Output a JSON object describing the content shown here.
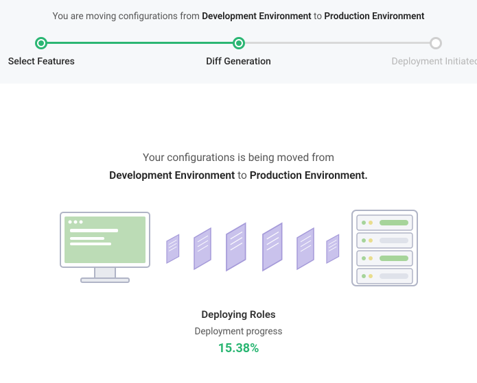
{
  "header": {
    "prefix": "You are moving configurations from",
    "from_env": "Development Environment",
    "mid": "to",
    "to_env": "Production Environment"
  },
  "stepper": {
    "steps": [
      {
        "label": "Select Features",
        "state": "done",
        "pos": 3
      },
      {
        "label": "Diff Generation",
        "state": "done",
        "pos": 50
      },
      {
        "label": "Deployment Initiated",
        "state": "todo",
        "pos": 97
      }
    ]
  },
  "body": {
    "line1": "Your configurations is being moved from",
    "from_env": "Development Environment",
    "mid": "to",
    "to_env": "Production Environment."
  },
  "status": {
    "task": "Deploying Roles",
    "label": "Deployment progress",
    "percent": "15.38%"
  },
  "colors": {
    "green": "#2bb673",
    "grey": "#cfcfcf",
    "purple": "#a59ad9",
    "purple_light": "#c9c2ec",
    "monitor_green": "#bcdcb6",
    "monitor_stroke": "#b0b4c6",
    "server_stroke": "#b0b4c6",
    "led_green": "#a6d49a",
    "led_yellow": "#e9dd8e"
  }
}
